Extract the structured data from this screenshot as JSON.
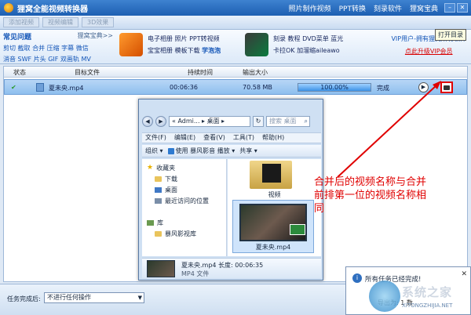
{
  "window": {
    "title": "狸窝全能视频转换器"
  },
  "title_links": [
    "照片制作视频",
    "PPT转换",
    "刻录软件",
    "狸窝宝典"
  ],
  "toolbar": [
    "添加视频",
    "视频编辑",
    "3D效果"
  ],
  "banner": {
    "faq_title": "常见问题",
    "faq_more": "狸窝宝典>>",
    "faq_line1": "剪切 截取 合并 压缩 字幕 微信",
    "faq_line2": "消音 SWF 片头 GIF 双画轨 MV",
    "promo1_line1": "电子相册 照片 PPT转视频",
    "promo1_line2a": "宝宝相册 模板下载 ",
    "promo1_line2b": "学泡泡",
    "promo2_line1": "刻录 教程 DVD菜单 蓝光",
    "promo2_line2": "卡拉OK 加溜缩aileawo",
    "vip_line1": "VIP用户-拥有狸窝所有软件",
    "vip_line2": "点此升级VIP会员"
  },
  "table": {
    "headers": {
      "status": "状态",
      "target": "目标文件",
      "duration": "持续时间",
      "size": "输出大小"
    },
    "row": {
      "status_icon": "✔",
      "file": "夏未央.mp4",
      "duration": "00:06:36",
      "size": "70.58 MB",
      "progress_text": "100.00%",
      "progress": 100,
      "state": "完成"
    }
  },
  "tooltip": "打开目录",
  "explorer": {
    "address": "« Admi... ▸ 桌面 ▸",
    "search_placeholder": "搜索 桌面",
    "menu": [
      "文件(F)",
      "编辑(E)",
      "查看(V)",
      "工具(T)",
      "帮助(H)"
    ],
    "cmdbar": [
      "组织 ▾",
      "使用 暴风影音 播放 ▾",
      "共享 ▾"
    ],
    "nav": {
      "favorites": "收藏夹",
      "downloads": "下载",
      "desktop": "桌面",
      "recent": "最近访问的位置",
      "library": "库",
      "storm": "暴风影视库"
    },
    "folder_label": "视频",
    "video_label": "夏未央.mp4",
    "details_name": "夏未央.mp4 长度: 00:06:35",
    "details_type": "MP4 文件"
  },
  "annotation": "合并后的视频名称与合并前排第一位的视频名称相同",
  "footer": {
    "label": "任务完成后:",
    "select_value": "不进行任何操作"
  },
  "toast": {
    "text": "所有任务已经完成!",
    "sub": "导出为: 1 数"
  },
  "watermark": {
    "text": "系统之家",
    "url": "XITONGZHIJIA.NET"
  }
}
